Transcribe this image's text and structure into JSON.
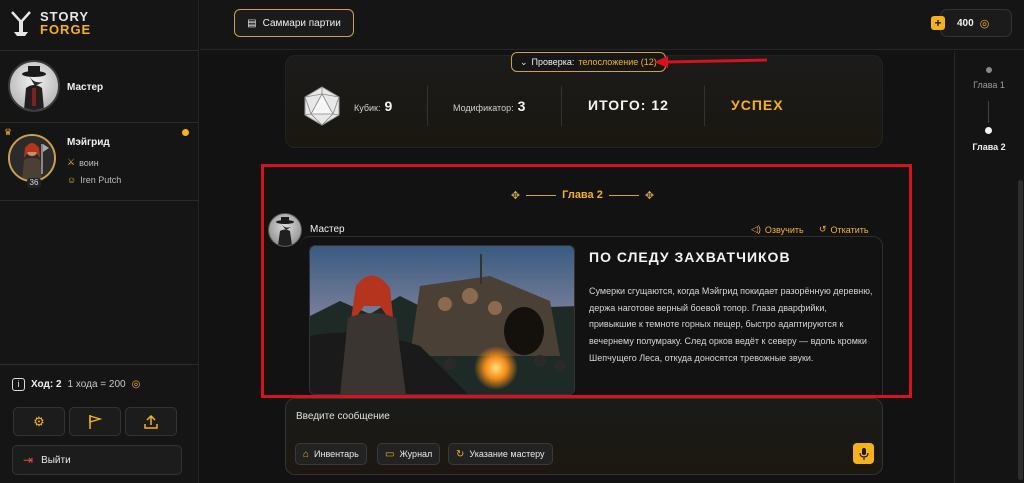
{
  "app": {
    "logo_line1": "STORY",
    "logo_line2": "FORGE"
  },
  "header": {
    "summary_button": "Саммари партии",
    "balance": "400"
  },
  "sidebar": {
    "master": {
      "name": "Мастер"
    },
    "player": {
      "name": "Мэйгрид",
      "class": "воин",
      "user": "Iren Putch",
      "level": "36"
    },
    "turn": {
      "label": "Ход: 2",
      "rate": "1 хода = 200"
    },
    "exit_button": "Выйти"
  },
  "check": {
    "pill_label": "Проверка:",
    "pill_value": "телосложение (12)",
    "dice_label": "Кубик:",
    "dice_value": "9",
    "modifier_label": "Модификатор:",
    "modifier_value": "3",
    "total": "ИТОГО: 12",
    "result": "УСПЕХ"
  },
  "chapter": {
    "title": "Глава 2"
  },
  "message": {
    "author": "Мастер",
    "voice_action": "Озвучить",
    "undo_action": "Откатить",
    "title": "ПО СЛЕДУ ЗАХВАТЧИКОВ",
    "text": "Сумерки сгущаются, когда Мэйгрид покидает разорённую деревню, держа наготове верный боевой топор. Глаза дварфийки, привыкшие к темноте горных пещер, быстро адаптируются к вечернему полумраку. След орков ведёт к северу — вдоль кромки Шепчущего Леса, откуда доносятся тревожные звуки."
  },
  "composer": {
    "placeholder": "Введите сообщение",
    "inventory": "Инвентарь",
    "journal": "Журнал",
    "hint": "Указание мастеру"
  },
  "timeline": {
    "items": [
      "Глава 1",
      "Глава 2"
    ],
    "active": "Глава 2"
  },
  "colors": {
    "accent": "#f5b21b",
    "annotation_red": "#d6121a",
    "background": "#121212"
  }
}
